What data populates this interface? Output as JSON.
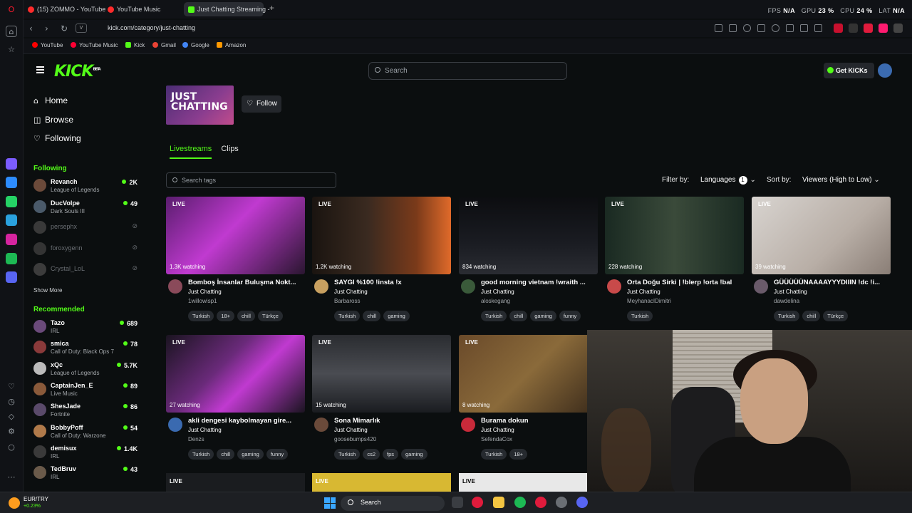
{
  "browser": {
    "tabs": [
      {
        "label": "(15) ZOMMO - YouTube"
      },
      {
        "label": "YouTube Music"
      },
      {
        "label": "Just Chatting Streaming -"
      }
    ],
    "url": "kick.com/category/just-chatting",
    "vbadge": "V",
    "sysmon": {
      "fps_label": "FPS",
      "fps": "N/A",
      "gpu_label": "GPU",
      "gpu": "23 %",
      "cpu_label": "CPU",
      "cpu": "24 %",
      "lat_label": "LAT",
      "lat": "N/A"
    },
    "bookmarks": [
      {
        "label": "YouTube",
        "color": "#ff0000"
      },
      {
        "label": "YouTube Music",
        "color": "#ff0033"
      },
      {
        "label": "Kick",
        "color": "#53fc18"
      },
      {
        "label": "Gmail",
        "color": "#ea4335"
      },
      {
        "label": "Google",
        "color": "#4285f4"
      },
      {
        "label": "Amazon",
        "color": "#ff9900"
      }
    ]
  },
  "kick": {
    "logo": "KICK",
    "logo_beta": "BETA",
    "search_placeholder": "Search",
    "get_kicks": "Get KICKs",
    "accent": "#53fc18"
  },
  "sidebar": {
    "nav": [
      {
        "label": "Home",
        "icon": "home-icon",
        "glyph": "⌂"
      },
      {
        "label": "Browse",
        "icon": "browse-icon",
        "glyph": "◫"
      },
      {
        "label": "Following",
        "icon": "heart-icon",
        "glyph": "♡"
      }
    ],
    "following_title": "Following",
    "following": [
      {
        "name": "Revanch",
        "game": "League of Legends",
        "viewers": "2K",
        "online": true,
        "color": "#6b4a3a"
      },
      {
        "name": "DucVolpe",
        "game": "Dark Souls III",
        "viewers": "49",
        "online": true,
        "color": "#4a5a6a"
      },
      {
        "name": "persephx",
        "online": false,
        "color": "#8a6a7a"
      },
      {
        "name": "foroxygenn",
        "online": false,
        "color": "#5a6a8a"
      },
      {
        "name": "Crystal_LoL",
        "online": false,
        "color": "#7a7a5a"
      }
    ],
    "show_more": "Show More",
    "recommended_title": "Recommended",
    "recommended": [
      {
        "name": "Tazo",
        "game": "IRL",
        "viewers": "689",
        "color": "#6a4a7a"
      },
      {
        "name": "smica",
        "game": "Call of Duty: Black Ops 7",
        "viewers": "78",
        "color": "#8a3a3a"
      },
      {
        "name": "xQc",
        "game": "League of Legends",
        "viewers": "5.7K",
        "color": "#bbbbbb"
      },
      {
        "name": "CaptainJen_E",
        "game": "Live Music",
        "viewers": "89",
        "color": "#8a5a3a"
      },
      {
        "name": "ShesJade",
        "game": "Fortnite",
        "viewers": "86",
        "color": "#5a4a6a"
      },
      {
        "name": "BobbyPoff",
        "game": "Call of Duty: Warzone",
        "viewers": "54",
        "color": "#b07a4a"
      },
      {
        "name": "demisux",
        "game": "IRL",
        "viewers": "1.4K",
        "color": "#3a3a3a"
      },
      {
        "name": "TedBruv",
        "game": "IRL",
        "viewers": "43",
        "color": "#6a5a4a"
      }
    ]
  },
  "category": {
    "thumb_text": "JUST CHATTING",
    "follow": "Follow",
    "tabs": [
      "Livestreams",
      "Clips"
    ],
    "tag_search_placeholder": "Search tags",
    "filter_label": "Filter by:",
    "languages": "Languages",
    "languages_count": "1",
    "sort_label": "Sort by:",
    "sort_value": "Viewers (High to Low)"
  },
  "streams": [
    {
      "title": "Bomboş İnsanlar Buluşma Nokt...",
      "category": "Just Chatting",
      "user": "1willowisp1",
      "viewers": "1.3K watching",
      "tags": [
        "Turkish",
        "18+",
        "chill",
        "Türkçe"
      ],
      "thumb": "linear-gradient(135deg,#5a1d6e 0%,#c03ad0 45%,#2a1630 100%)",
      "avatar": "#8a4a5a"
    },
    {
      "title": "SAYGI %100 !insta !x",
      "category": "Just Chatting",
      "user": "Barbaross",
      "viewers": "1.2K watching",
      "tags": [
        "Turkish",
        "chill",
        "gaming"
      ],
      "thumb": "linear-gradient(90deg,#1a1410 0%,#3a2a20 40%,#7a3a1a 75%,#e06a2a 100%)",
      "avatar": "#c8a060"
    },
    {
      "title": "good morning vietnam !wraith ...",
      "category": "Just Chatting",
      "user": "aloskegang",
      "viewers": "834 watching",
      "tags": [
        "Turkish",
        "chill",
        "gaming",
        "funny"
      ],
      "thumb": "linear-gradient(180deg,#0c0d10 0%,#1a1c22 60%,#2a2c32 100%)",
      "avatar": "#3a5a3a"
    },
    {
      "title": "Orta Doğu Sirki | !blerp !orta !bal",
      "category": "Just Chatting",
      "user": "MeyhanacIDimitri",
      "viewers": "228 watching",
      "tags": [
        "Turkish"
      ],
      "thumb": "linear-gradient(90deg,#1a2a22 0%,#3a4a3a 50%,#1a2a22 100%)",
      "avatar": "#c84a4a"
    },
    {
      "title": "GÜÜÜÜÜNAAAAYYYDIIIN !dc !i...",
      "category": "Just Chatting",
      "user": "dawdelina",
      "viewers": "39 watching",
      "tags": [
        "Turkish",
        "chill",
        "Türkçe"
      ],
      "thumb": "linear-gradient(135deg,#d8d4d0 0%,#b8aea6 60%,#8a7e76 100%)",
      "avatar": "#6a5a6a"
    },
    {
      "title": "akli dengesi kaybolmayan gire...",
      "category": "Just Chatting",
      "user": "Denzs",
      "viewers": "27 watching",
      "tags": [
        "Turkish",
        "chill",
        "gaming",
        "funny"
      ],
      "thumb": "linear-gradient(135deg,#1a1420 0%,#6a2a7a 40%,#c03ad0 60%,#1a1420 100%)",
      "avatar": "#3a6ab0"
    },
    {
      "title": "Sona Mimarlık",
      "category": "Just Chatting",
      "user": "goosebumps420",
      "viewers": "15 watching",
      "tags": [
        "Turkish",
        "cs2",
        "fps",
        "gaming"
      ],
      "thumb": "linear-gradient(180deg,#2a2c30 0%,#4a4c52 50%,#1a1c20 100%)",
      "avatar": "#6a4a3a"
    },
    {
      "title": "Burama dokun",
      "category": "Just Chatting",
      "user": "SefendaCox",
      "viewers": "8 watching",
      "tags": [
        "Turkish",
        "18+"
      ],
      "thumb": "linear-gradient(135deg,#6a4a2a 0%,#8a6a3a 50%,#3a2a1a 100%)",
      "avatar": "#c82a3a"
    }
  ],
  "stream_live_label": "LIVE",
  "taskbar": {
    "ticker_pair": "EUR/TRY",
    "ticker_change": "+0.23%",
    "search": "Search"
  }
}
